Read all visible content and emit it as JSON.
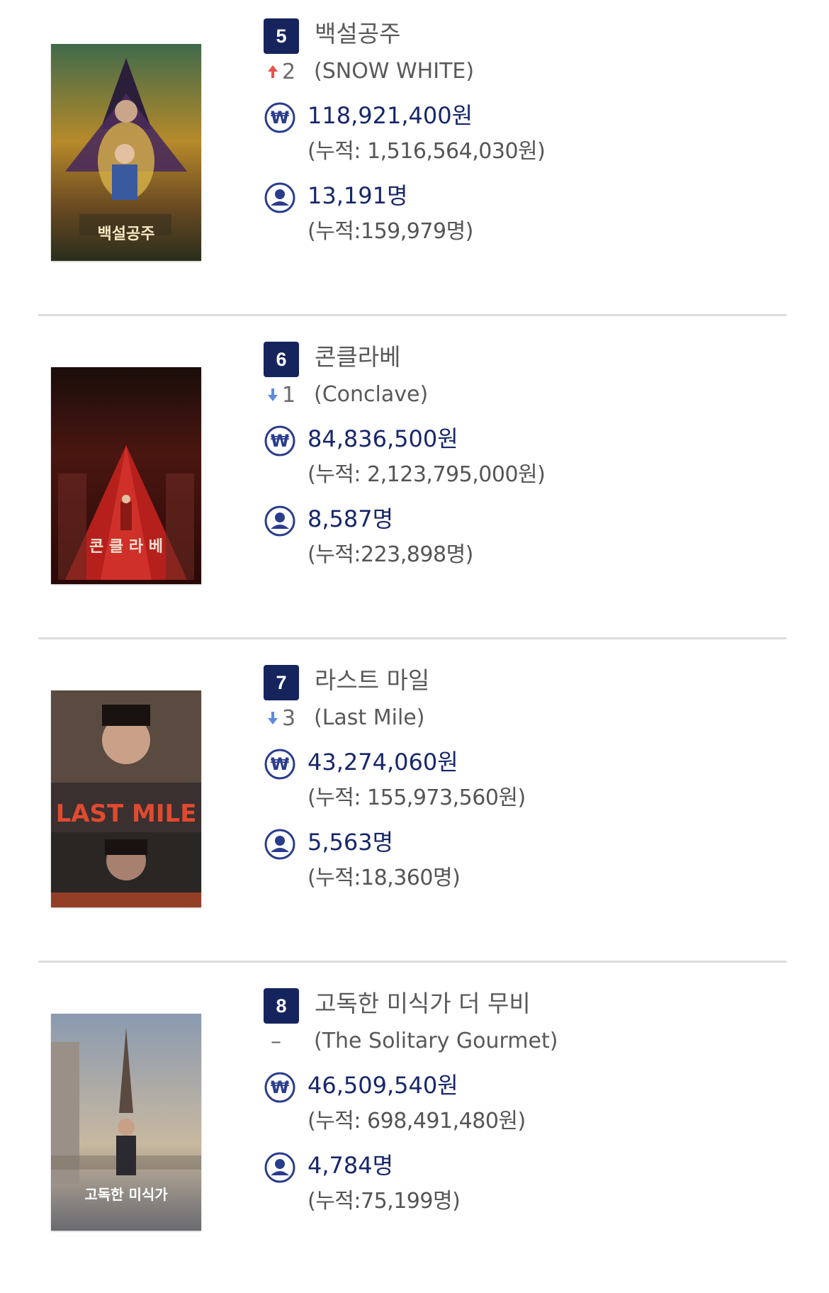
{
  "items": [
    {
      "rank": "5",
      "title_ko": "백설공주",
      "title_en": "(SNOW WHITE)",
      "change_direction": "up",
      "change_value": "2",
      "revenue": "118,921,400원",
      "revenue_cumulative": "(누적: 1,516,564,030원)",
      "audience": "13,191명",
      "audience_cumulative": "(누적:159,979명)",
      "poster_text": "백설공주"
    },
    {
      "rank": "6",
      "title_ko": "콘클라베",
      "title_en": "(Conclave)",
      "change_direction": "down",
      "change_value": "1",
      "revenue": "84,836,500원",
      "revenue_cumulative": "(누적: 2,123,795,000원)",
      "audience": "8,587명",
      "audience_cumulative": "(누적:223,898명)",
      "poster_text": "콘 클 라 베"
    },
    {
      "rank": "7",
      "title_ko": "라스트 마일",
      "title_en": "(Last Mile)",
      "change_direction": "down",
      "change_value": "3",
      "revenue": "43,274,060원",
      "revenue_cumulative": "(누적: 155,973,560원)",
      "audience": "5,563명",
      "audience_cumulative": "(누적:18,360명)",
      "poster_text": "LAST MILE"
    },
    {
      "rank": "8",
      "title_ko": "고독한 미식가 더 무비",
      "title_en": "(The Solitary Gourmet)",
      "change_direction": "none",
      "change_value": "–",
      "revenue": "46,509,540원",
      "revenue_cumulative": "(누적: 698,491,480원)",
      "audience": "4,784명",
      "audience_cumulative": "(누적:75,199명)",
      "poster_text": "고독한 미식가"
    }
  ],
  "icons": {
    "revenue": "won-icon",
    "audience": "person-icon",
    "up": "arrow-up-icon",
    "down": "arrow-down-icon"
  },
  "colors": {
    "navy": "#16245e",
    "up_arrow": "#e8534a",
    "down_arrow": "#5b8be0",
    "icon_blue": "#2a3c8c"
  }
}
